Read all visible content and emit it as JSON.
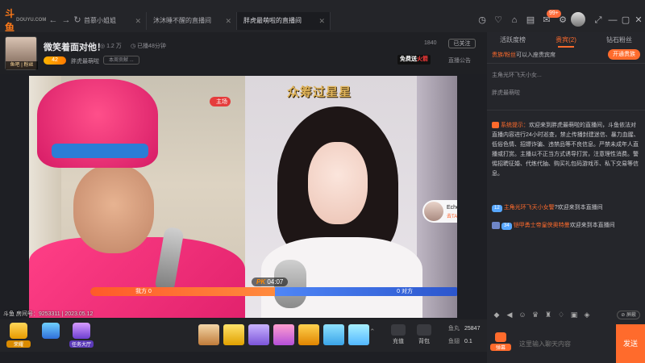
{
  "app": {
    "logo": "斗鱼",
    "logo_sub": "DOUYU.COM"
  },
  "nav": {
    "back": "←",
    "forward": "→",
    "refresh": "↻"
  },
  "tabs": [
    {
      "label": "首慕小姐姐"
    },
    {
      "label": "沐沐睡不醒的直播间"
    },
    {
      "label": "胖虎最萌啦的直播间"
    }
  ],
  "tab_close": "✕",
  "window_icons": {
    "badge": "99+"
  },
  "room": {
    "title": "微笑着面对他！",
    "avatar_tag": "鱼吧 | 粉丝",
    "views": "1.2 万",
    "duration": "已播48分钟",
    "level": "42",
    "anchor": "胖虎最萌啦",
    "fans_btn": "本周贡献 ...",
    "count": "1840",
    "follow": "已关注",
    "free_gift": "免费送",
    "free_gift_hot": "火箭",
    "announcement": "直播公告"
  },
  "video": {
    "overlay_text": "众筹过星星",
    "host_tag": "主场",
    "echo_name": "Echo盼盼",
    "echo_go": "去TA的直播间",
    "pk_timer": "04:07",
    "pk_badge": "PK",
    "pk_left": "我方 0",
    "pk_right": "0 对方",
    "pk_left_share": 0.5,
    "footer": "斗鱼 房间号：9253311 | 2023.05.12"
  },
  "toolbar": {
    "items": [
      {
        "label": "荣耀"
      },
      {
        "label": "任务大厅"
      }
    ],
    "charge": "充值",
    "backpack": "背包",
    "fishball_label": "鱼丸",
    "fishball_value": "25847",
    "fishbean_label": "鱼翅",
    "fishbean_value": "0.1"
  },
  "panel": {
    "tabs": [
      {
        "label": "活跃度榜"
      },
      {
        "label": "贵宾(2)"
      },
      {
        "label": "钻石粉丝"
      }
    ],
    "noble_prefix": "贵族/粉丝",
    "noble_text": "可以入座贵宾席",
    "noble_btn": "开通贵族",
    "line1": "主角光环飞天小女...",
    "line2": "胖虎最萌啦",
    "sys_label": "系统提示：",
    "sys_msg": "欢迎来到胖虎最萌啦的直播间，斗鱼依法对直播内容进行24小时巡查，禁止传播封建迷信、暴力血腥、低俗色情、招嫖诈骗、违禁品等不良信息。严禁未成年人直播或打赏。主播以不正当方式诱导打赏，注意理性消费。警惕招聘征婚、代练代抽、购买礼包码游戏币、私下交易等信息。",
    "chat1_lvl": "12",
    "chat1_user": "主角光环飞天小女警",
    "chat1_msg": "?欢迎来到本直播间",
    "chat2_lvl": "34",
    "chat2_user": "铠甲勇士帝皇侠奥特曼",
    "chat2_msg": "欢迎来到本直播间",
    "shield": "屏蔽",
    "bullet_btn": "弹幕",
    "input_placeholder": "这里输入聊天内容",
    "send": "发送"
  }
}
